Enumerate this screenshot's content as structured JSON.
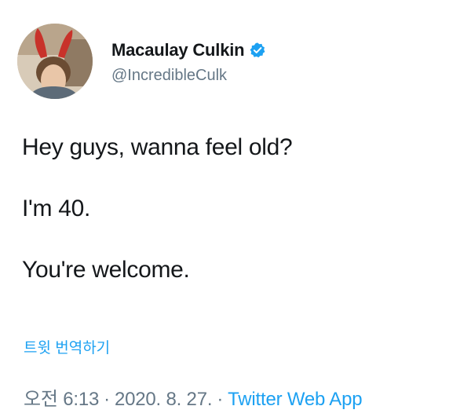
{
  "author": {
    "display_name": "Macaulay Culkin",
    "handle": "@IncredibleCulk",
    "verified_icon": "verified-badge-icon",
    "verified_color": "#1DA1F2"
  },
  "tweet": {
    "lines": [
      "Hey guys, wanna feel old?",
      "I'm 40.",
      "You're welcome."
    ],
    "translate_label": "트윗 번역하기"
  },
  "meta": {
    "time": "오전 6:13",
    "separator": "·",
    "date": "2020. 8. 27.",
    "source": "Twitter Web App"
  },
  "colors": {
    "text": "#14171A",
    "secondary": "#657786",
    "link": "#1DA1F2"
  }
}
